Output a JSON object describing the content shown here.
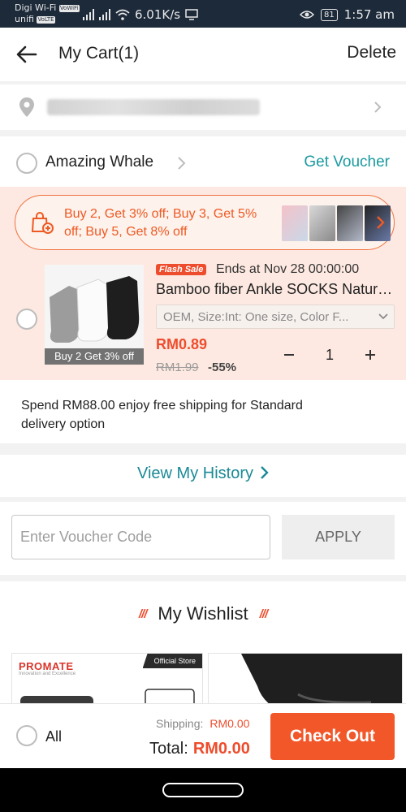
{
  "status_bar": {
    "carrier_1": "Digi Wi-Fi",
    "carrier_1_tag": "VoWiFi",
    "carrier_2": "unifi",
    "carrier_2_tag": "VoLTE",
    "net_speed": "6.01K/s",
    "battery": "81",
    "time": "1:57 am"
  },
  "header": {
    "title": "My Cart(1)",
    "delete_label": "Delete"
  },
  "shop": {
    "name": "Amazing Whale",
    "voucher_label": "Get Voucher",
    "promo_text": "Buy 2, Get 3% off; Buy 3, Get 5% off; Buy 5, Get 8% off",
    "item": {
      "image_caption": "Buy 2 Get 3% off",
      "flash_badge": "Flash Sale",
      "flash_ends": "Ends at Nov 28 00:00:00",
      "title": "Bamboo fiber Ankle SOCKS Natural Antibacterial",
      "variation": "OEM, Size:Int: One size, Color F...",
      "price": "RM0.89",
      "original_price": "RM1.99",
      "discount": "-55%",
      "quantity": "1"
    },
    "shipping_note": "Spend RM88.00 enjoy free shipping for Standard delivery option"
  },
  "history": {
    "label": "View My History"
  },
  "voucher": {
    "placeholder": "Enter Voucher Code",
    "apply_label": "APPLY"
  },
  "wishlist": {
    "title": "My Wishlist",
    "card1_brand": "PROMATE",
    "card1_brand_sub": "Innovation and Excellence",
    "card1_badge": "Official Store"
  },
  "bottom_bar": {
    "all_label": "All",
    "shipping_label": "Shipping:",
    "shipping_value": "RM0.00",
    "total_label": "Total:",
    "total_value": "RM0.00",
    "checkout_label": "Check Out"
  },
  "colors": {
    "accent": "#ee4d2d",
    "teal": "#1a9aa0",
    "promo_bg": "#fde9e1"
  }
}
